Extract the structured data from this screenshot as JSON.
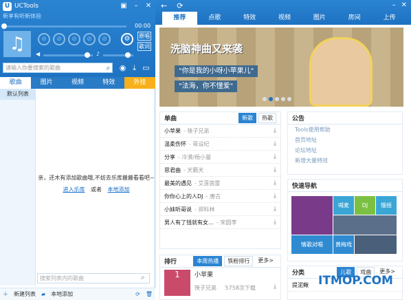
{
  "left": {
    "title": "UCTools",
    "subtitle": "新享有听新体验",
    "time": "00:00",
    "side_btn1": "原唱",
    "side_btn2": "歌词",
    "search_placeholder": "请输入你要搜索的歌曲",
    "tabs": [
      "歌曲",
      "图片",
      "视频",
      "特效",
      "外挂"
    ],
    "default_list": "默认列表",
    "empty_msg": "亲，还木有添加歌曲哦,不妨去乐库搬搬看看吧~",
    "link1": "进入乐库",
    "or": "或者",
    "link2": "本地添加",
    "list_search_placeholder": "搜索列表内的歌曲",
    "new_list": "新建列表",
    "local_add": "本地添加"
  },
  "right": {
    "tabs": [
      "推荐",
      "点歌",
      "特效",
      "视频",
      "图片",
      "房间",
      "上传"
    ],
    "banner": {
      "title": "洗脑神曲又来袭",
      "line1": "\"你是我的小呀小苹果儿\"",
      "line2": "\"法海，你不懂爱\""
    },
    "songs_title": "单曲",
    "songs_tabs": [
      "新歌",
      "热歌"
    ],
    "songs": [
      {
        "name": "小苹果",
        "artist": "- 筷子兄弟"
      },
      {
        "name": "温柔伤怀",
        "artist": "- 蒋设纪"
      },
      {
        "name": "分享",
        "artist": "- 冷漠/杨小曼"
      },
      {
        "name": "思君曲",
        "artist": "- 天籁天"
      },
      {
        "name": "最美的遇见",
        "artist": "- 艾莲茵雷"
      },
      {
        "name": "你你心上的人DJ",
        "artist": "- 唐古"
      },
      {
        "name": "小妹听哥说",
        "artist": "- 郑科林"
      },
      {
        "name": "男人有了钱就有女…",
        "artist": "- 宋圆李"
      }
    ],
    "notice_title": "公告",
    "notices": [
      "Tools使用帮助",
      "首页地址",
      "论坛地址",
      "新增大量特效"
    ],
    "nav_title": "快速导航",
    "nav_cells": [
      "",
      "喊麦",
      "DJ",
      "慢摇",
      "",
      "",
      "",
      "情歌对唱",
      "黄梅戏",
      ""
    ],
    "rank_title": "排行",
    "rank_tabs": [
      "本周热播",
      "铁粉排行"
    ],
    "rank_more": "更多>",
    "rank_song": "小苹果",
    "rank_artist": "筷子兄弟",
    "rank_count": "5758次下载",
    "cat_title": "分类",
    "cat_tabs": [
      "儿歌",
      "戏曲"
    ],
    "cat_more": "更多>",
    "cat_item": "提泥鳅",
    "watermark": "ITMOP.COM"
  }
}
